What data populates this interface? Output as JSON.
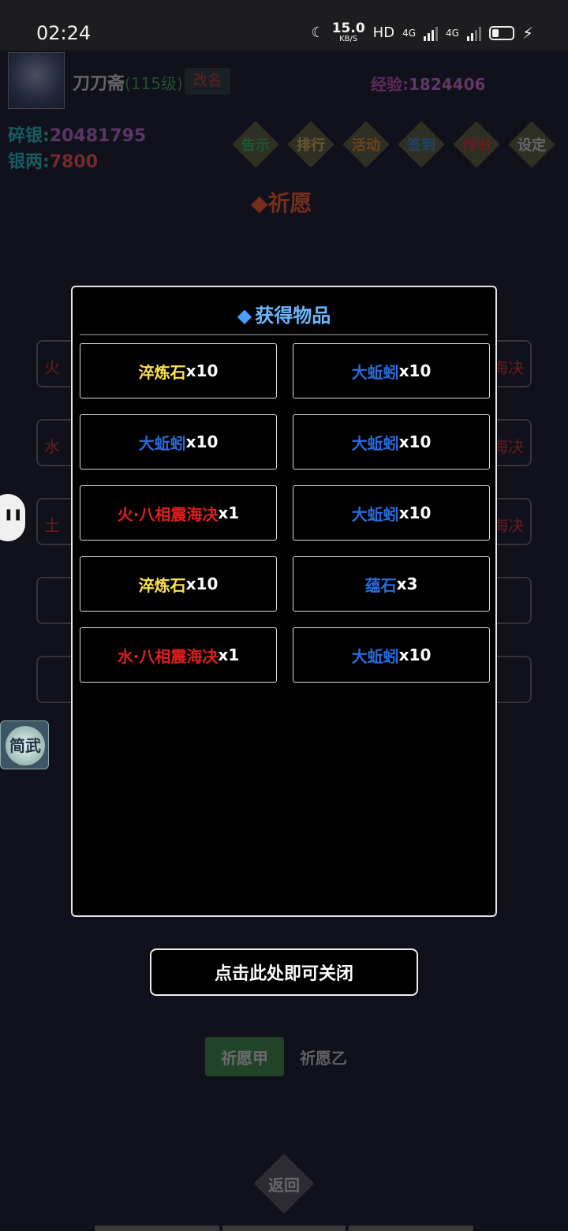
{
  "status_bar": {
    "time": "02:24",
    "net_speed_value": "15.0",
    "net_speed_unit": "KB/S",
    "hd": "HD",
    "sim1": "4G",
    "sim2": "4G"
  },
  "player": {
    "name": "刀刀斋",
    "level": "(115级)",
    "rename_label": "改名",
    "exp_label": "经验:",
    "exp_value": "1824406"
  },
  "currency": {
    "silver_fragments_label": "碎银:",
    "silver_fragments_value": "20481795",
    "silver_taels_label": "银两:",
    "silver_taels_value": "7800"
  },
  "menu": [
    {
      "label": "告示",
      "color": "#2fbf4a"
    },
    {
      "label": "排行",
      "color": "#e8c24a"
    },
    {
      "label": "活动",
      "color": "#f08a1a"
    },
    {
      "label": "签到",
      "color": "#2e8fd8"
    },
    {
      "label": "传书",
      "color": "#e02b2b"
    },
    {
      "label": "设定",
      "color": "#dcdcdc"
    }
  ],
  "section_title": "◆祈愿",
  "background_rows": [
    {
      "left": "火",
      "right": "海决"
    },
    {
      "left": "水",
      "right": "海决"
    },
    {
      "left": "土",
      "right": "海决"
    },
    {
      "left": "",
      "right": ""
    },
    {
      "left": "",
      "right": ""
    }
  ],
  "float_logo_text": "简武",
  "modal": {
    "title": "获得物品",
    "items": [
      {
        "name": "淬炼石",
        "qty": "x10",
        "color": "#ffe14d"
      },
      {
        "name": "大蚯蚓",
        "qty": "x10",
        "color": "#2a6bd9"
      },
      {
        "name": "大蚯蚓",
        "qty": "x10",
        "color": "#2a6bd9"
      },
      {
        "name": "大蚯蚓",
        "qty": "x10",
        "color": "#2a6bd9"
      },
      {
        "name": "火·八相震海决",
        "qty": "x1",
        "color": "#e01e1e"
      },
      {
        "name": "大蚯蚓",
        "qty": "x10",
        "color": "#2a6bd9"
      },
      {
        "name": "淬炼石",
        "qty": "x10",
        "color": "#ffe14d"
      },
      {
        "name": "蕴石",
        "qty": "x3",
        "color": "#2a6bd9"
      },
      {
        "name": "水·八相震海决",
        "qty": "x1",
        "color": "#e01e1e"
      },
      {
        "name": "大蚯蚓",
        "qty": "x10",
        "color": "#2a6bd9"
      }
    ]
  },
  "close_label": "点击此处即可关闭",
  "tabs": {
    "wish_a": "祈愿甲",
    "wish_b": "祈愿乙"
  },
  "back_label": "返回"
}
